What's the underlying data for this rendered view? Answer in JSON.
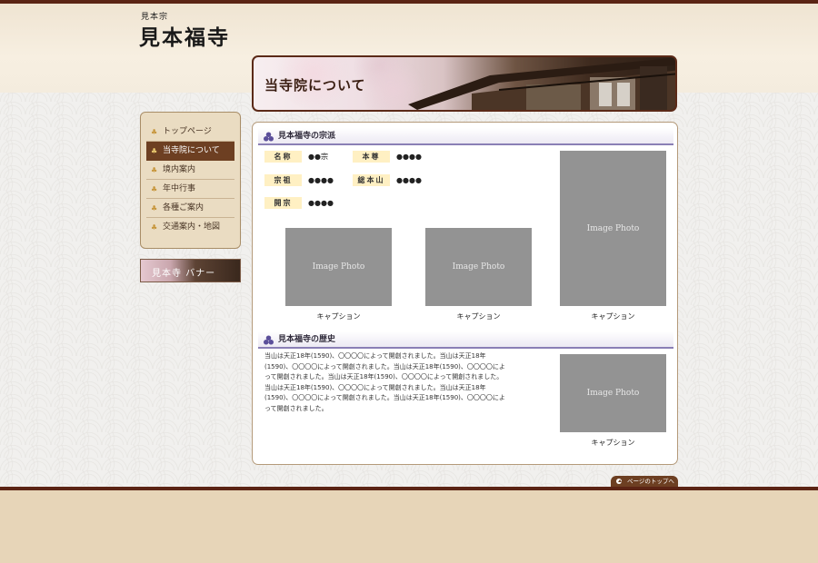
{
  "header": {
    "subtitle": "見本宗",
    "title": "見本福寺"
  },
  "hero": {
    "title": "当寺院について"
  },
  "sidebar": {
    "items": [
      {
        "label": "トップページ"
      },
      {
        "label": "当寺院について"
      },
      {
        "label": "境内案内"
      },
      {
        "label": "年中行事"
      },
      {
        "label": "各種ご案内"
      },
      {
        "label": "交通案内・地図"
      }
    ],
    "banner_label": "見本寺 バナー"
  },
  "section1": {
    "title": "見本福寺の宗派",
    "rows": [
      {
        "label": "名称",
        "value": "●●宗"
      },
      {
        "label": "本尊",
        "value": "●●●●"
      },
      {
        "label": "宗祖",
        "value": "●●●●"
      },
      {
        "label": "総本山",
        "value": "●●●●"
      },
      {
        "label": "開宗",
        "value": "●●●●"
      }
    ],
    "photos": [
      {
        "text": "Image Photo",
        "caption": "キャプション"
      },
      {
        "text": "Image Photo",
        "caption": "キャプション"
      },
      {
        "text": "Image Photo",
        "caption": "キャプション"
      }
    ]
  },
  "section2": {
    "title": "見本福寺の歴史",
    "text": "当山は天正18年(1590)、〇〇〇〇によって開創されました。当山は天正18年(1590)、〇〇〇〇によって開創されました。当山は天正18年(1590)、〇〇〇〇によって開創されました。当山は天正18年(1590)、〇〇〇〇によって開創されました。当山は天正18年(1590)、〇〇〇〇によって開創されました。当山は天正18年(1590)、〇〇〇〇によって開創されました。当山は天正18年(1590)、〇〇〇〇によって開創されました。",
    "photo": {
      "text": "Image Photo",
      "caption": "キャプション"
    }
  },
  "to_top": {
    "label": "ページのトップへ"
  },
  "colors": {
    "accent": "#6d3f22",
    "line": "#5b2414",
    "label_bg": "#fff0c3",
    "heading_rule": "#8a7fb5"
  }
}
